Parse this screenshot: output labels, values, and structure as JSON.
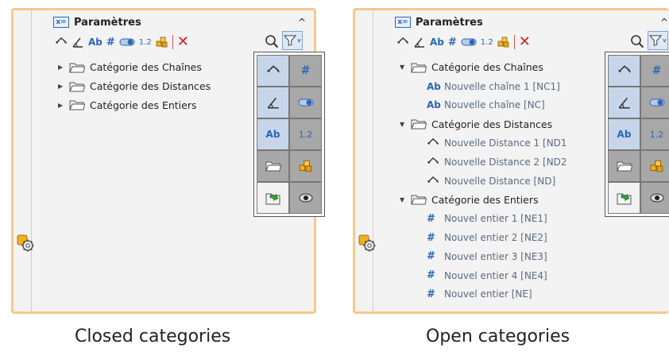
{
  "left_panel": {
    "title": "Paramètres",
    "title_icon": "x=",
    "categories": [
      {
        "label": "Catégorie des Chaînes",
        "expanded": false
      },
      {
        "label": "Catégorie des Distances",
        "expanded": false
      },
      {
        "label": "Catégorie des Entiers",
        "expanded": false
      }
    ],
    "caption": "Closed categories"
  },
  "right_panel": {
    "title": "Paramètres",
    "title_icon": "x=",
    "categories": [
      {
        "label": "Catégorie des Chaînes",
        "expanded": true,
        "icon": "ab-icon",
        "children": [
          "Nouvelle chaîne 1 [NC1]",
          "Nouvelle chaîne [NC]"
        ]
      },
      {
        "label": "Catégorie des Distances",
        "expanded": true,
        "icon": "distance-icon",
        "children": [
          "Nouvelle Distance 1 [ND1",
          "Nouvelle Distance 2 [ND2",
          "Nouvelle Distance [ND]"
        ]
      },
      {
        "label": "Catégorie des Entiers",
        "expanded": true,
        "icon": "hash-icon",
        "children": [
          "Nouvel entier 1 [NE1]",
          "Nouvel entier 2 [NE2]",
          "Nouvel entier 3 [NE3]",
          "Nouvel entier 4 [NE4]",
          "Nouvel entier [NE]"
        ]
      }
    ],
    "caption": "Open categories"
  },
  "toolbar": {
    "ab": "Ab",
    "hash": "#",
    "decimal": "1.2",
    "delete": "✕"
  },
  "filter_grid": {
    "ab": "Ab",
    "hash": "#",
    "decimal": "1.2"
  },
  "icons": [
    "x-equals-icon",
    "distance-icon",
    "angle-icon",
    "ab-icon",
    "hash-icon",
    "toggle-icon",
    "decimal-icon",
    "blocks-icon",
    "delete-icon",
    "search-icon",
    "filter-icon",
    "folder-icon",
    "import-icon",
    "visibility-icon",
    "parameters-gear-icon"
  ],
  "colors": {
    "accent": "#2b67b5",
    "panel_border": "#f6c98a",
    "delete": "#d62020"
  }
}
